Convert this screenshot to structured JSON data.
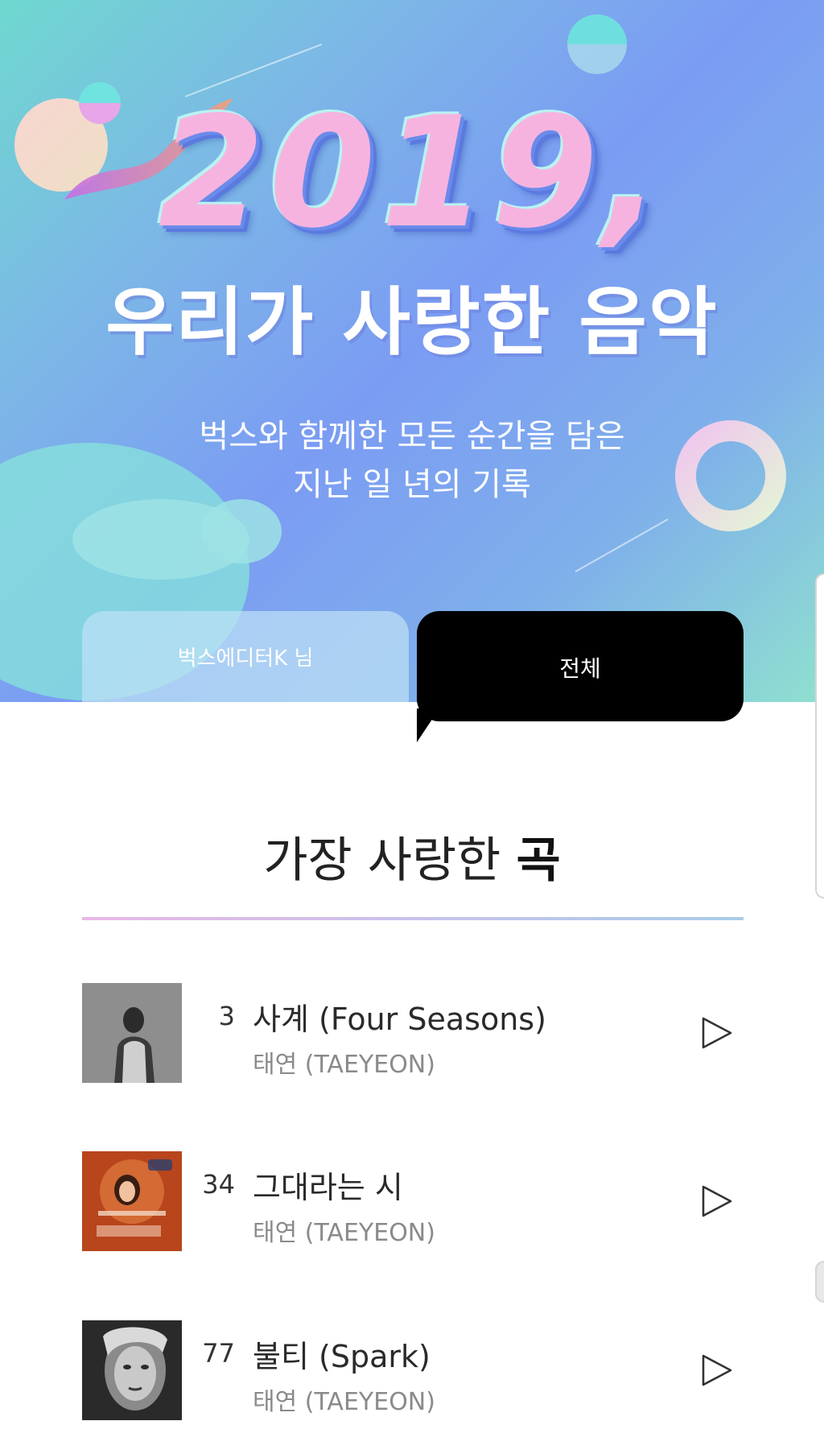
{
  "hero": {
    "year": "2019,",
    "headline": "우리가 사랑한 음악",
    "subtitle_line1": "벅스와 함께한 모든 순간을 담은",
    "subtitle_line2": "지난 일 년의 기록"
  },
  "tabs": {
    "mine": "벅스에디터K 님",
    "all": "전체",
    "selected": "all"
  },
  "section": {
    "title_prefix": "가장 사랑한",
    "title_emphasis": "곡"
  },
  "songs": [
    {
      "rank": "3",
      "title": "사계 (Four Seasons)",
      "artist": "태연 (TAEYEON)",
      "cover": "grayscale portrait"
    },
    {
      "rank": "34",
      "title": "그대라는 시",
      "artist": "태연 (TAEYEON)",
      "cover": "orange OST cover"
    },
    {
      "rank": "77",
      "title": "불티 (Spark)",
      "artist": "태연 (TAEYEON)",
      "cover": "monochrome close-up"
    }
  ],
  "icons": {
    "play": "play-triangle-icon"
  },
  "colors": {
    "tab_active_bg": "#000000",
    "divider_start": "#e9b8e6",
    "divider_end": "#a9cde6"
  }
}
